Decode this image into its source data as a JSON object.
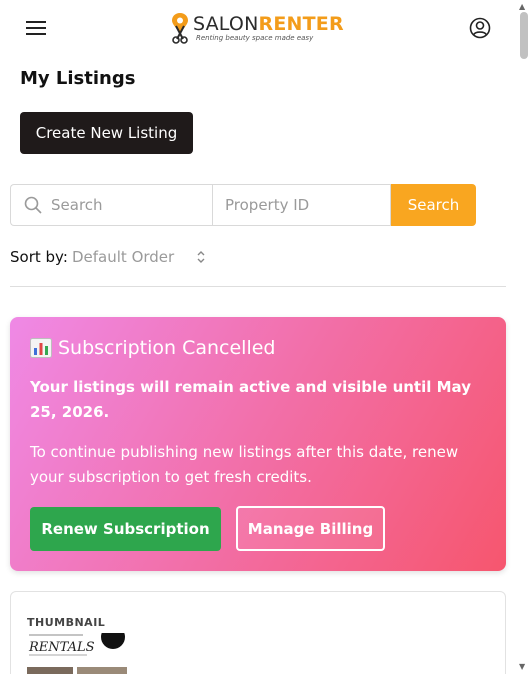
{
  "header": {
    "logo_primary": "SALON",
    "logo_secondary": "RENTER",
    "logo_tagline": "Renting beauty space made easy",
    "accent_color": "#f39c1a"
  },
  "page": {
    "title": "My Listings",
    "create_button_label": "Create New Listing"
  },
  "search": {
    "search_placeholder": "Search",
    "property_id_placeholder": "Property ID",
    "button_label": "Search",
    "button_color": "#f9a620"
  },
  "sort": {
    "label": "Sort by:",
    "selected": "Default Order"
  },
  "subscription": {
    "title": "Subscription Cancelled",
    "message_primary": "Your listings will remain active and visible until May 25, 2026.",
    "message_secondary": "To continue publishing new listings after this date, renew your subscription to get fresh credits.",
    "renew_label": "Renew Subscription",
    "billing_label": "Manage Billing",
    "renew_color": "#2ea64d"
  },
  "listing": {
    "thumbnail_header": "THUMBNAIL",
    "thumbnail_text": "RENTALS"
  }
}
